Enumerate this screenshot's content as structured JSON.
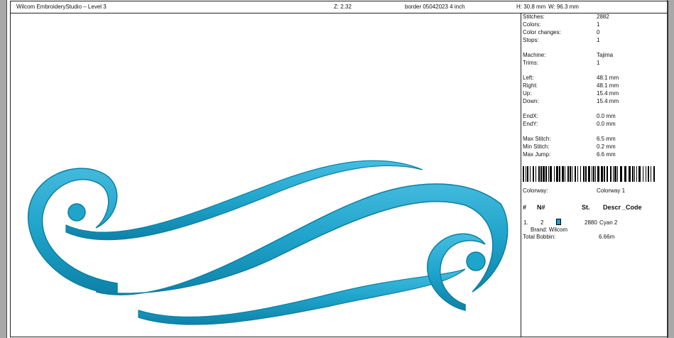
{
  "header": {
    "app_title": "Wilcom EmbroideryStudio – Level 3",
    "zoom": "Z: 2.32",
    "design_name": "border 05042023 4 inch",
    "height": "H: 30.8 mm",
    "width": "W: 96.3 mm"
  },
  "stats": [
    {
      "label": "Stitches:",
      "value": "2882"
    },
    {
      "label": "Colors:",
      "value": "1"
    },
    {
      "label": "Color changes:",
      "value": "0"
    },
    {
      "label": "Stops:",
      "value": "1"
    }
  ],
  "machine": [
    {
      "label": "Machine:",
      "value": "Tajima"
    },
    {
      "label": "Trims:",
      "value": "1"
    }
  ],
  "extents": [
    {
      "label": "Left:",
      "value": "48.1 mm"
    },
    {
      "label": "Right:",
      "value": "48.1 mm"
    },
    {
      "label": "Up:",
      "value": "15.4 mm"
    },
    {
      "label": "Down:",
      "value": "15.4 mm"
    }
  ],
  "end": [
    {
      "label": "EndX:",
      "value": "0.0 mm"
    },
    {
      "label": "EndY:",
      "value": "0.0 mm"
    }
  ],
  "limits": [
    {
      "label": "Max Stitch:",
      "value": "6.5 mm"
    },
    {
      "label": "Min Stitch:",
      "value": "0.2 mm"
    },
    {
      "label": "Max Jump:",
      "value": "6.6 mm"
    }
  ],
  "colorway": {
    "label": "Colorway:",
    "value": "Colorway 1"
  },
  "thread_table": {
    "headers": {
      "num": "#",
      "needle": "N#",
      "stitches": "St.",
      "descr": "Descr",
      "code": "_Code"
    },
    "rows": [
      {
        "num": "1.",
        "needle": "2",
        "stitches": "2880",
        "descr": "Cyan 2",
        "color": "#1a9fd0"
      }
    ],
    "brand": "Brand: Wilcom"
  },
  "bobbin": {
    "label": "Total Bobbin:",
    "value": "6.66m"
  },
  "colors": {
    "thread": "#1fa5cc",
    "thread_dark": "#0e7fa3",
    "thread_light": "#5cc8e6"
  }
}
